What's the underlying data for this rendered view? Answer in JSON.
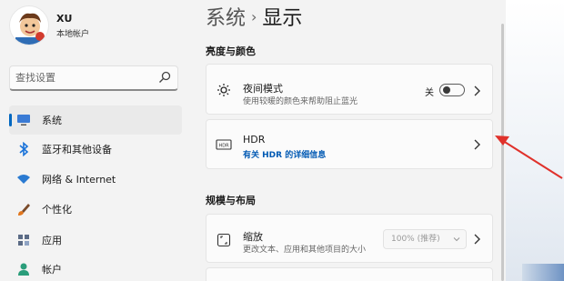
{
  "profile": {
    "name": "XU",
    "account_type": "本地帐户",
    "avatar": "cartoon-avatar"
  },
  "search": {
    "placeholder": "查找设置"
  },
  "sidebar": {
    "items": [
      {
        "label": "系统",
        "icon": "monitor-icon",
        "selected": true
      },
      {
        "label": "蓝牙和其他设备",
        "icon": "bluetooth-icon",
        "selected": false
      },
      {
        "label": "网络 & Internet",
        "icon": "wifi-icon",
        "selected": false
      },
      {
        "label": "个性化",
        "icon": "brush-icon",
        "selected": false
      },
      {
        "label": "应用",
        "icon": "apps-icon",
        "selected": false
      },
      {
        "label": "帐户",
        "icon": "person-icon",
        "selected": false
      }
    ]
  },
  "breadcrumb": {
    "parent": "系统",
    "separator": "›",
    "current": "显示"
  },
  "sections": {
    "brightness": {
      "title": "亮度与颜色",
      "night_light": {
        "title": "夜间模式",
        "subtitle": "使用较暖的颜色来帮助阻止蓝光",
        "toggle_label": "关",
        "toggle_on": false
      },
      "hdr": {
        "title": "HDR",
        "subtitle": "有关 HDR 的详细信息"
      }
    },
    "layout": {
      "title": "规模与布局",
      "scale": {
        "title": "缩放",
        "subtitle": "更改文本、应用和其他项目的大小",
        "value": "100% (推荐)"
      }
    }
  },
  "colors": {
    "accent": "#0067c0",
    "link": "#0059b3",
    "arrow": "#e0312b"
  }
}
